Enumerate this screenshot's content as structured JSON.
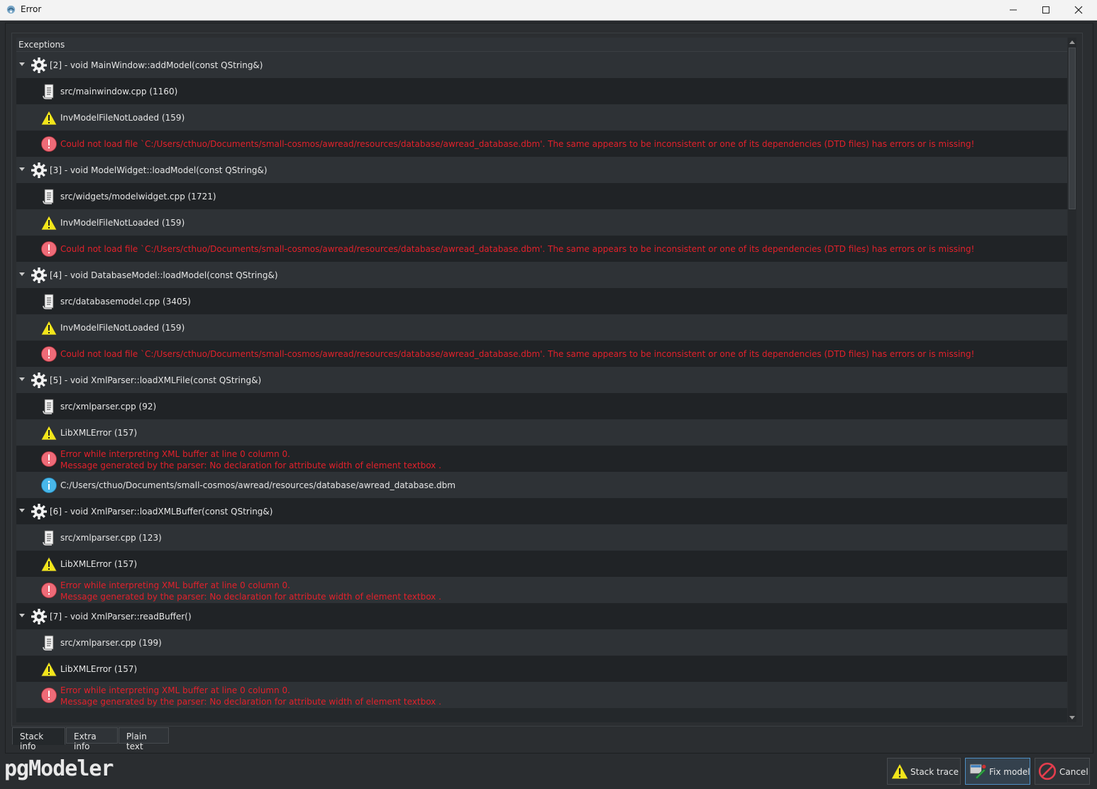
{
  "window": {
    "title": "Error",
    "minimize_icon": "minimize-icon",
    "maximize_icon": "maximize-icon",
    "close_icon": "close-icon"
  },
  "tree": {
    "header": "Exceptions",
    "rows": [
      {
        "level": 0,
        "icon": "gear-icon",
        "text": "[2] - void MainWindow::addModel(const QString&)"
      },
      {
        "level": 1,
        "icon": "source-file-icon",
        "text": "src/mainwindow.cpp (1160)"
      },
      {
        "level": 1,
        "icon": "warning-icon",
        "text": "InvModelFileNotLoaded (159)"
      },
      {
        "level": 1,
        "icon": "error-icon",
        "text": "Could not load file `C:/Users/cthuo/Documents/small-cosmos/awread/resources/database/awread_database.dbm'. The same appears to be inconsistent or one of its dependencies (DTD files) has errors or is missing!"
      },
      {
        "level": 0,
        "icon": "gear-icon",
        "text": "[3] - void ModelWidget::loadModel(const QString&)"
      },
      {
        "level": 1,
        "icon": "source-file-icon",
        "text": "src/widgets/modelwidget.cpp (1721)"
      },
      {
        "level": 1,
        "icon": "warning-icon",
        "text": "InvModelFileNotLoaded (159)"
      },
      {
        "level": 1,
        "icon": "error-icon",
        "text": "Could not load file `C:/Users/cthuo/Documents/small-cosmos/awread/resources/database/awread_database.dbm'. The same appears to be inconsistent or one of its dependencies (DTD files) has errors or is missing!"
      },
      {
        "level": 0,
        "icon": "gear-icon",
        "text": "[4] - void DatabaseModel::loadModel(const QString&)"
      },
      {
        "level": 1,
        "icon": "source-file-icon",
        "text": "src/databasemodel.cpp (3405)"
      },
      {
        "level": 1,
        "icon": "warning-icon",
        "text": "InvModelFileNotLoaded (159)"
      },
      {
        "level": 1,
        "icon": "error-icon",
        "text": "Could not load file `C:/Users/cthuo/Documents/small-cosmos/awread/resources/database/awread_database.dbm'. The same appears to be inconsistent or one of its dependencies (DTD files) has errors or is missing!"
      },
      {
        "level": 0,
        "icon": "gear-icon",
        "text": "[5] - void XmlParser::loadXMLFile(const QString&)"
      },
      {
        "level": 1,
        "icon": "source-file-icon",
        "text": "src/xmlparser.cpp (92)"
      },
      {
        "level": 1,
        "icon": "warning-icon",
        "text": "LibXMLError (157)"
      },
      {
        "level": 1,
        "icon": "error-icon",
        "text": "Error while interpreting XML buffer at line 0 column 0.",
        "text2": "Message generated by the parser: No declaration for attribute width of element textbox ."
      },
      {
        "level": 1,
        "icon": "info-icon",
        "text": "C:/Users/cthuo/Documents/small-cosmos/awread/resources/database/awread_database.dbm"
      },
      {
        "level": 0,
        "icon": "gear-icon",
        "text": "[6] - void XmlParser::loadXMLBuffer(const QString&)"
      },
      {
        "level": 1,
        "icon": "source-file-icon",
        "text": "src/xmlparser.cpp (123)"
      },
      {
        "level": 1,
        "icon": "warning-icon",
        "text": "LibXMLError (157)"
      },
      {
        "level": 1,
        "icon": "error-icon",
        "text": "Error while interpreting XML buffer at line 0 column 0.",
        "text2": "Message generated by the parser: No declaration for attribute width of element textbox ."
      },
      {
        "level": 0,
        "icon": "gear-icon",
        "text": "[7] - void XmlParser::readBuffer()"
      },
      {
        "level": 1,
        "icon": "source-file-icon",
        "text": "src/xmlparser.cpp (199)"
      },
      {
        "level": 1,
        "icon": "warning-icon",
        "text": "LibXMLError (157)"
      },
      {
        "level": 1,
        "icon": "error-icon",
        "text": "Error while interpreting XML buffer at line 0 column 0.",
        "text2": "Message generated by the parser: No declaration for attribute width of element textbox ."
      }
    ]
  },
  "tabs": {
    "stack_info": "Stack info",
    "extra_info": "Extra info",
    "plain_text": "Plain text"
  },
  "footer": {
    "logo": "pgModeler",
    "stack_trace": "Stack trace",
    "fix_model": "Fix model",
    "cancel": "Cancel"
  },
  "colors": {
    "error_text": "#e2212b",
    "background": "#2a2d30",
    "highlight": "#4e8fc4"
  }
}
